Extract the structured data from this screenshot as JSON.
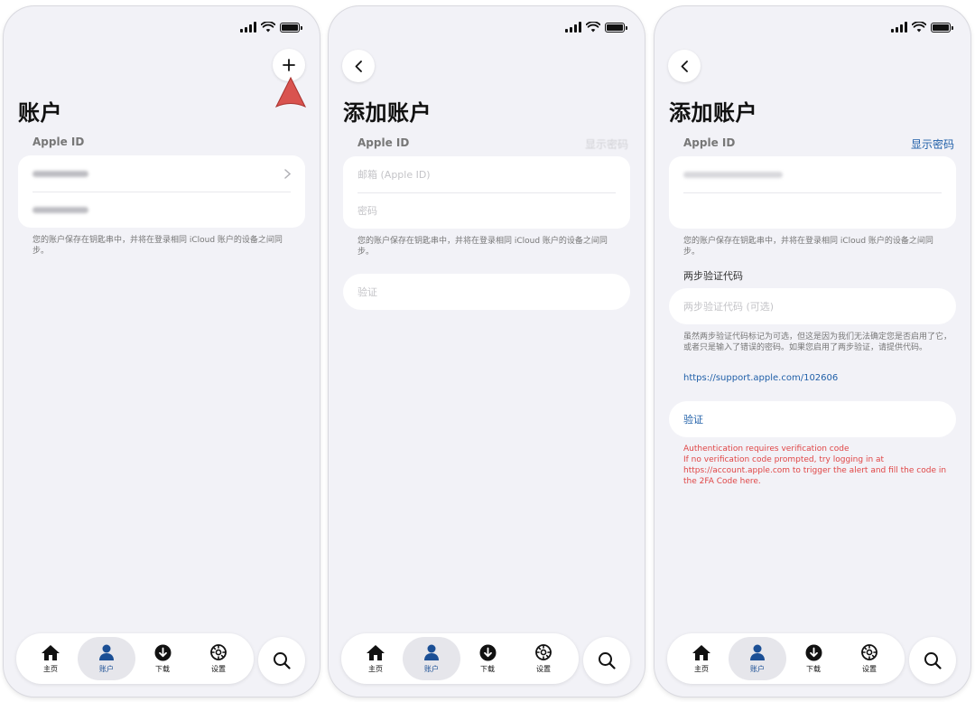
{
  "screen1": {
    "title": "账户",
    "section_label": "Apple ID",
    "note": "您的账户保存在钥匙串中，并将在登录相同 iCloud 账户的设备之间同步。"
  },
  "screen2": {
    "title": "添加账户",
    "section_label": "Apple ID",
    "show_password": "显示密码",
    "email_placeholder": "邮箱 (Apple ID)",
    "password_placeholder": "密码",
    "note": "您的账户保存在钥匙串中，并将在登录相同 iCloud 账户的设备之间同步。",
    "verify_button": "验证"
  },
  "screen3": {
    "title": "添加账户",
    "section_label": "Apple ID",
    "show_password": "显示密码",
    "note": "您的账户保存在钥匙串中，并将在登录相同 iCloud 账户的设备之间同步。",
    "twofa_label": "两步验证代码",
    "twofa_placeholder": "两步验证代码 (可选)",
    "twofa_note": "虽然两步验证代码标记为可选，但这是因为我们无法确定您是否启用了它，或者只是输入了错误的密码。如果您启用了两步验证，请提供代码。",
    "support_link": "https://support.apple.com/102606",
    "verify_button": "验证",
    "error_line1": "Authentication requires verification code",
    "error_line2": "If no verification code prompted, try logging in at https://account.apple.com to trigger the alert and fill the code in the 2FA Code here."
  },
  "tabbar": {
    "home": "主页",
    "account": "账户",
    "download": "下载",
    "settings": "设置"
  },
  "colors": {
    "accent": "#1b4f95",
    "link": "#1f5fa8",
    "error": "#e04646",
    "background": "#f2f2f7",
    "arrow": "#d9534f"
  },
  "icons": [
    "add-icon",
    "back-icon",
    "home-icon",
    "person-icon",
    "download-icon",
    "gear-icon",
    "search-icon",
    "chevron-right-icon"
  ]
}
